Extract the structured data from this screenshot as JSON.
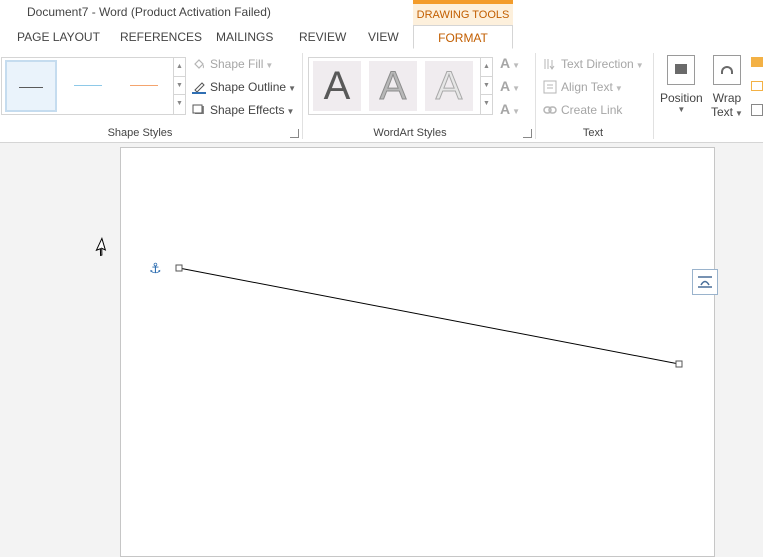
{
  "window": {
    "title": "Document7 - Word (Product Activation Failed)",
    "contextual_tab_group": "DRAWING TOOLS"
  },
  "tabs": [
    "PAGE LAYOUT",
    "REFERENCES",
    "MAILINGS",
    "REVIEW",
    "VIEW",
    "FORMAT"
  ],
  "active_tab": "FORMAT",
  "ribbon": {
    "shape_styles": {
      "label": "Shape Styles",
      "samples": [
        {
          "line_color": "#5a5a5a",
          "selected": true
        },
        {
          "line_color": "#8ec9e8",
          "selected": false
        },
        {
          "line_color": "#f4a46e",
          "selected": false
        }
      ],
      "shape_fill": "Shape Fill",
      "shape_outline": "Shape Outline",
      "shape_effects": "Shape Effects"
    },
    "wordart_styles": {
      "label": "WordArt Styles",
      "sample_letter": "A"
    },
    "text": {
      "label": "Text",
      "text_direction": "Text Direction",
      "align_text": "Align Text",
      "create_link": "Create Link"
    },
    "arrange": {
      "position": "Position",
      "wrap_text_line1": "Wrap",
      "wrap_text_line2": "Text"
    }
  },
  "colors": {
    "accent_orange": "#c25e00",
    "contextual_bar": "#f39c2b",
    "outline_pen_blue": "#2f6fb3"
  }
}
